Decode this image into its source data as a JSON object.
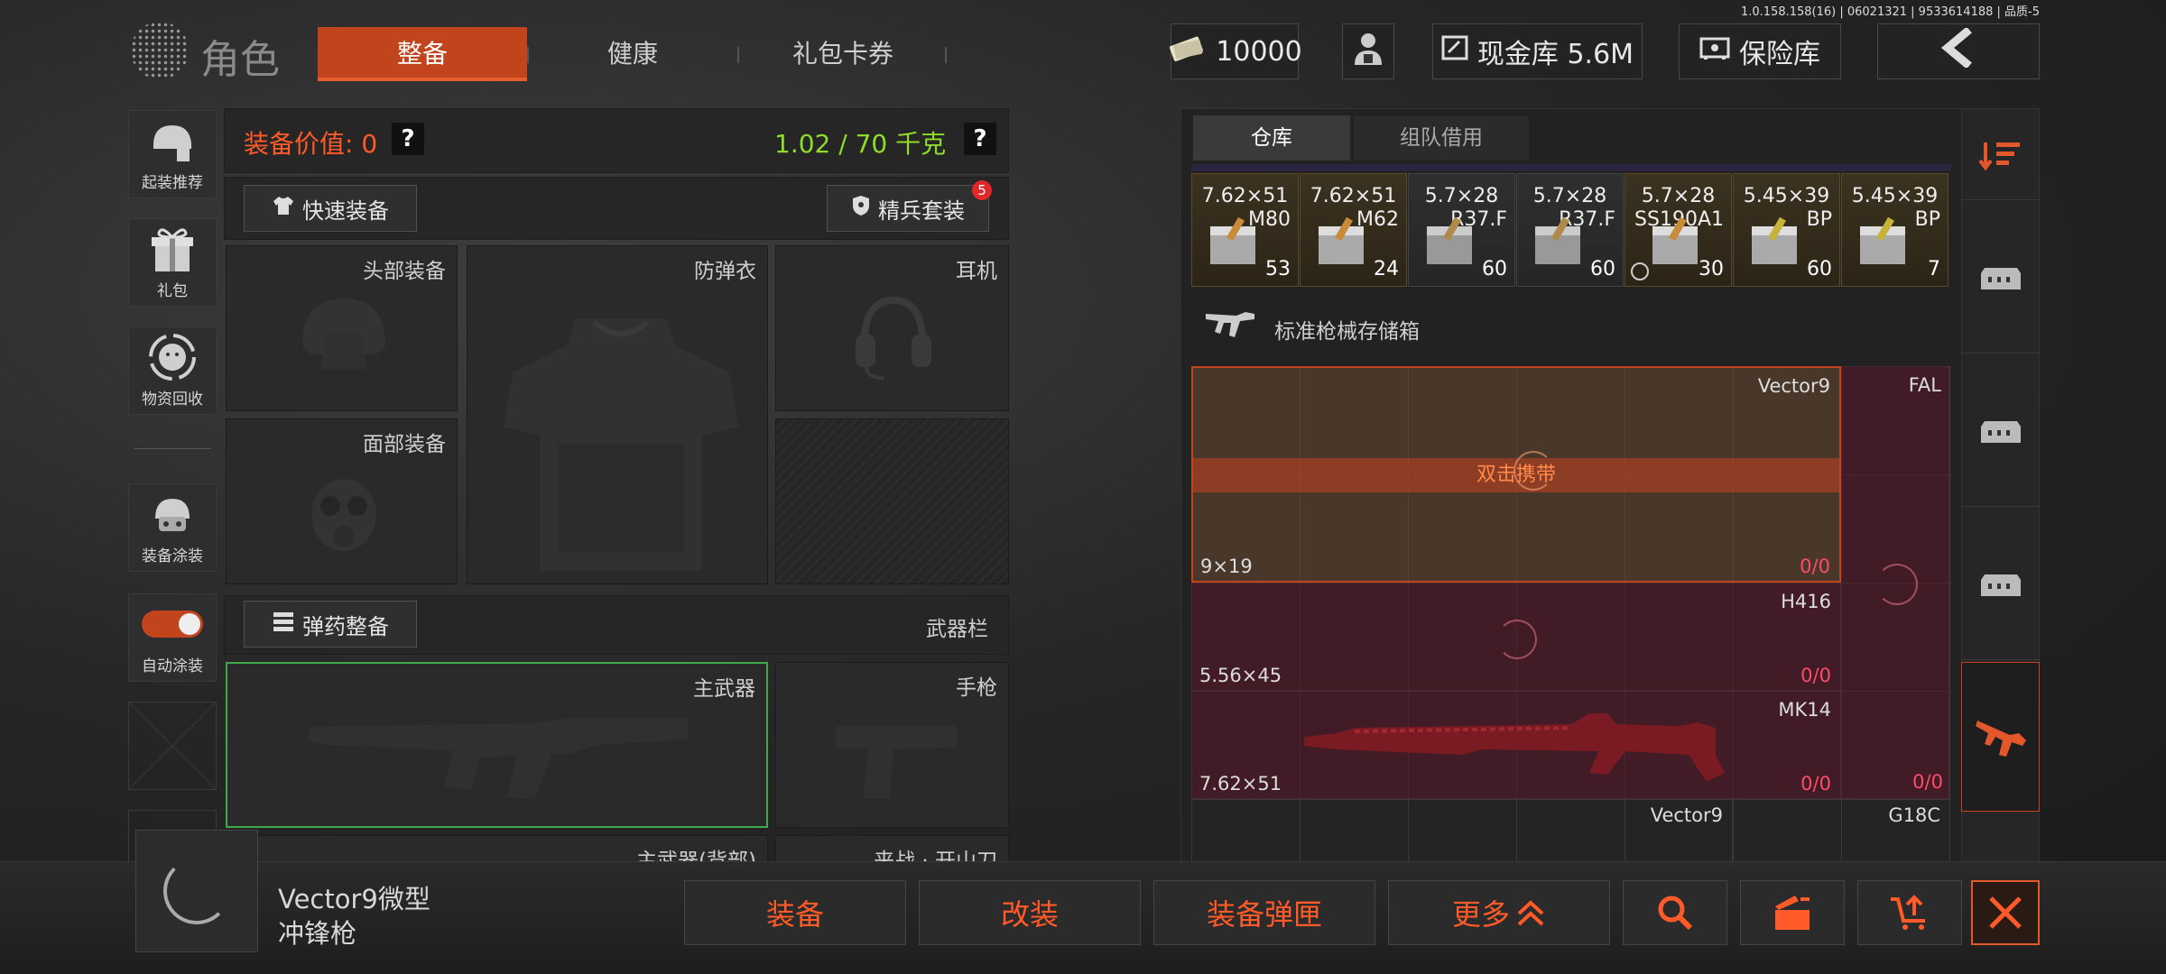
{
  "version": "1.0.158.158(16) | 06021321 | 9533614188 | 品质-5",
  "header": {
    "title": "角色",
    "tabs": [
      "整备",
      "健康",
      "礼包卡券"
    ],
    "cash": "10000",
    "cash_vault": "现金库 5.6M",
    "safe": "保险库"
  },
  "sidebar": [
    {
      "label": "起装推荐",
      "icon": "helmet-loadout-icon"
    },
    {
      "label": "礼包",
      "icon": "gift-icon"
    },
    {
      "label": "物资回收",
      "icon": "recycle-merchant-icon"
    },
    {
      "label": "装备涂装",
      "icon": "paint-helmet-icon"
    },
    {
      "label": "自动涂装",
      "icon": "toggle-icon"
    }
  ],
  "equipment": {
    "value_label": "装备价值: 0",
    "weight": "1.02 / 70 千克",
    "help": "?",
    "quick_equip": "快速装备",
    "elite_suit": "精兵套装",
    "elite_badge": "5",
    "slots": {
      "head": "头部装备",
      "armor": "防弹衣",
      "headset": "耳机",
      "face": "面部装备"
    },
    "ammo_equip": "弹药整备",
    "weapon_bar": "武器栏",
    "primary": "主武器",
    "pistol": "手枪",
    "primary_back": "主武器(背部)",
    "melee": "来战 · 开山刀"
  },
  "warehouse": {
    "tabs": [
      "仓库",
      "组队借用"
    ],
    "ammo": [
      {
        "cal": "7.62×51",
        "type": "M80",
        "qty": "53"
      },
      {
        "cal": "7.62×51",
        "type": "M62",
        "qty": "24"
      },
      {
        "cal": "5.7×28",
        "type": "R37.F",
        "qty": "60"
      },
      {
        "cal": "5.7×28",
        "type": "R37.F",
        "qty": "60"
      },
      {
        "cal": "5.7×28",
        "type": "SS190A1",
        "qty": "30"
      },
      {
        "cal": "5.45×39",
        "type": "BP",
        "qty": "60"
      },
      {
        "cal": "5.45×39",
        "type": "BP",
        "qty": "7"
      }
    ],
    "storage_box": "标准枪械存储箱",
    "weapons": {
      "vector9": {
        "name": "Vector9",
        "cal": "9×19",
        "ammo_a": "0",
        "ammo_b": "0",
        "hint": "双击携带"
      },
      "fal": {
        "name": "FAL"
      },
      "h416": {
        "name": "H416",
        "cal": "5.56×45",
        "ammo_a": "0",
        "ammo_b": "0"
      },
      "mk14": {
        "name": "MK14",
        "cal": "7.62×51",
        "ammo_a": "0",
        "ammo_b": "0"
      },
      "fal_ammo_a": "0",
      "fal_ammo_b": "0",
      "vector9_b": {
        "name": "Vector9"
      },
      "g18c": {
        "name": "G18C"
      }
    }
  },
  "bottom": {
    "selected_item": "Vector9微型冲锋枪",
    "equip": "装备",
    "modify": "改装",
    "equip_mag": "装备弹匣",
    "more": "更多"
  },
  "colors": {
    "accent": "#c2441d",
    "orange_text": "#ff5a28",
    "green": "#8fdc2a",
    "red_count": "#ff4a6a"
  }
}
